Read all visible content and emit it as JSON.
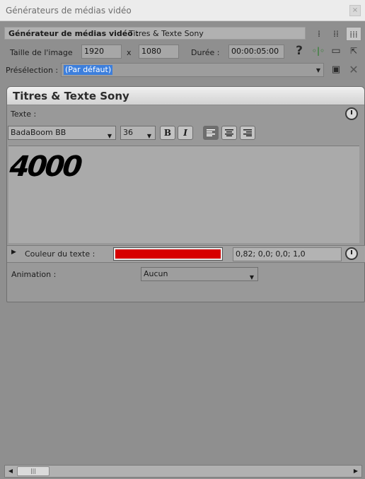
{
  "window": {
    "title": "Générateurs de médias vidéo",
    "close": "×"
  },
  "header": {
    "label": "Générateur de médias vidéo :",
    "plugin": "Titres & Texte Sony"
  },
  "view_icons": [
    "list-view-icon",
    "detail-view-icon",
    "grid-view-icon"
  ],
  "size": {
    "label": "Taille de l'image",
    "width": "1920",
    "sep": "x",
    "height": "1080"
  },
  "duration": {
    "label": "Durée :",
    "value": "00:00:05:00"
  },
  "toolbar_icons": [
    "help-icon",
    "split-icon",
    "monitor-icon",
    "export-icon"
  ],
  "preset": {
    "label": "Présélection :",
    "value": "(Par défaut)"
  },
  "panel": {
    "title": "Titres & Texte Sony"
  },
  "text": {
    "label": "Texte :",
    "font": "BadaBoom BB",
    "size": "36",
    "bold": "B",
    "italic": "I",
    "content": "4000"
  },
  "color": {
    "label": "Couleur du texte :",
    "value": "0,82; 0,0; 0,0; 1,0",
    "hex": "#d70000"
  },
  "animation": {
    "label": "Animation :",
    "value": "Aucun"
  }
}
